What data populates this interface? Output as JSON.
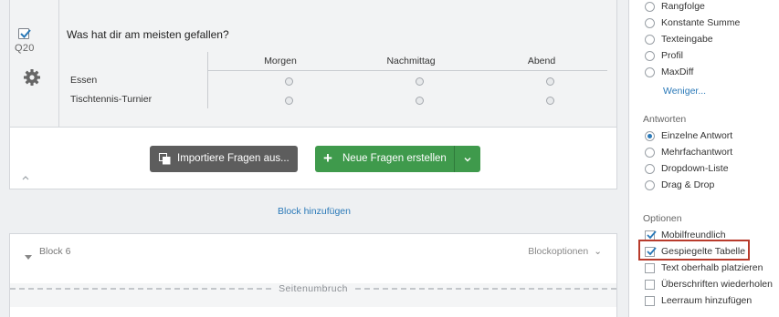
{
  "question": {
    "number": "Q20",
    "title": "Was hat dir am meisten gefallen?",
    "columns": [
      "Morgen",
      "Nachmittag",
      "Abend"
    ],
    "rows": [
      "Essen",
      "Tischtennis-Turnier"
    ]
  },
  "buttons": {
    "import_label": "Importiere Fragen aus...",
    "new_label": "Neue Fragen erstellen"
  },
  "add_block_label": "Block hinzufügen",
  "block": {
    "title": "Block 6",
    "options_label": "Blockoptionen",
    "page_break_label": "Seitenumbruch"
  },
  "panel": {
    "question_types": [
      "Rangfolge",
      "Konstante Summe",
      "Texteingabe",
      "Profil",
      "MaxDiff"
    ],
    "less_label": "Weniger...",
    "answers_heading": "Antworten",
    "answers": [
      "Einzelne Antwort",
      "Mehrfachantwort",
      "Dropdown-Liste",
      "Drag & Drop"
    ],
    "answers_selected_index": 0,
    "options_heading": "Optionen",
    "options": [
      {
        "label": "Mobilfreundlich",
        "checked": true
      },
      {
        "label": "Gespiegelte Tabelle",
        "checked": true
      },
      {
        "label": "Text oberhalb platzieren",
        "checked": false
      },
      {
        "label": "Überschriften wiederholen",
        "checked": false
      },
      {
        "label": "Leerraum hinzufügen",
        "checked": false
      }
    ]
  },
  "colors": {
    "accent_blue": "#2a79b8",
    "green_button": "#3f9a4c",
    "gray_button": "#5d5d5d",
    "highlight_red": "#b83b2c"
  }
}
